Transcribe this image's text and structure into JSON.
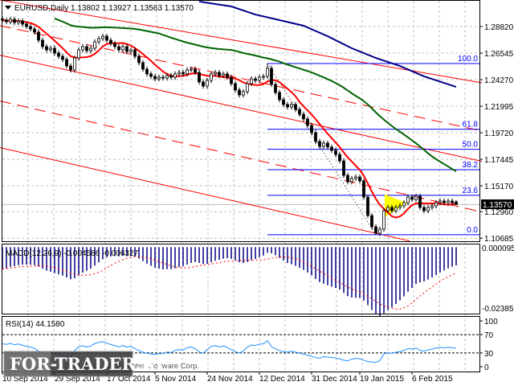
{
  "header": {
    "symbol": "EURUSD,Daily",
    "ohlc": "1.13802 1.13927 1.13563 1.13570"
  },
  "price_axis": {
    "ticks": [
      {
        "label": "1.28820",
        "value": 1.2882
      },
      {
        "label": "1.26545",
        "value": 1.26545
      },
      {
        "label": "1.24270",
        "value": 1.2427
      },
      {
        "label": "1.21995",
        "value": 1.21995
      },
      {
        "label": "1.19720",
        "value": 1.1972
      },
      {
        "label": "1.17445",
        "value": 1.17445
      },
      {
        "label": "1.15170",
        "value": 1.1517
      },
      {
        "label": "1.12960",
        "value": 1.1296
      },
      {
        "label": "1.10685",
        "value": 1.10685
      }
    ],
    "current_price": "1.13570",
    "current_value": 1.1357
  },
  "fibonacci": [
    {
      "label": "100.0",
      "value": 1.2565
    },
    {
      "label": "61.8",
      "value": 1.2002
    },
    {
      "label": "50.0",
      "value": 1.183
    },
    {
      "label": "38.2",
      "value": 1.1656
    },
    {
      "label": "23.6",
      "value": 1.1436
    },
    {
      "label": "0.0",
      "value": 1.1098
    }
  ],
  "macd": {
    "label": "MACD(12,26,9) -0.004586 -0.006327",
    "axis_max": "0.000095",
    "axis_min": "-0.023859",
    "max": 9.5e-05,
    "min": -0.023859
  },
  "rsi": {
    "label": "RSI(14) 44.1580",
    "levels": [
      {
        "label": "100",
        "value": 100
      },
      {
        "label": "70",
        "value": 70
      },
      {
        "label": "30",
        "value": 30
      },
      {
        "label": "0",
        "value": 0
      }
    ]
  },
  "dates": [
    {
      "label": "10 Sep 2014",
      "bar": 0
    },
    {
      "label": "29 Sep 2014",
      "bar": 13
    },
    {
      "label": "17 Oct 2014",
      "bar": 26
    },
    {
      "label": "5 Nov 2014",
      "bar": 38
    },
    {
      "label": "24 Nov 2014",
      "bar": 51
    },
    {
      "label": "12 Dec 2014",
      "bar": 64
    },
    {
      "label": "31 Dec 2014",
      "bar": 77
    },
    {
      "label": "19 Jan 2015",
      "bar": 89
    },
    {
      "label": "6 Feb 2015",
      "bar": 102
    }
  ],
  "watermark": {
    "logo": "FOR-TRADER.RU",
    "copyright": "MetaTrader 4, © 2001-2014, MetaQuotes Software Corp."
  },
  "colors": {
    "bull": "#ffffff",
    "bear": "#000000",
    "ma_fast": "#ff0000",
    "ma_mid": "#006400",
    "ma_slow": "#00008b",
    "fib": "#0000ff",
    "channel": "#ff0000",
    "macd_hist": "#000080",
    "macd_signal": "#ff0000",
    "rsi": "#1e90ff",
    "triangle": "#ffff00"
  },
  "chart_data": {
    "type": "candlestick",
    "title": "EURUSD,Daily",
    "last_bar": {
      "open": 1.13802,
      "high": 1.13927,
      "low": 1.13563,
      "close": 1.1357
    },
    "closes": [
      1.2937,
      1.2923,
      1.2944,
      1.2916,
      1.293,
      1.2903,
      1.2882,
      1.2861,
      1.2834,
      1.2765,
      1.271,
      1.2682,
      1.2696,
      1.2655,
      1.2627,
      1.26,
      1.2544,
      1.251,
      1.2613,
      1.2682,
      1.271,
      1.2675,
      1.2696,
      1.2751,
      1.2779,
      1.2799,
      1.2765,
      1.2737,
      1.271,
      1.2682,
      1.271,
      1.2668,
      1.2682,
      1.2627,
      1.2572,
      1.2517,
      1.2476,
      1.2455,
      1.2434,
      1.2448,
      1.2441,
      1.2462,
      1.2448,
      1.2476,
      1.2489,
      1.2476,
      1.251,
      1.2517,
      1.2489,
      1.2407,
      1.2372,
      1.242,
      1.2476,
      1.2489,
      1.2462,
      1.2476,
      1.2448,
      1.2393,
      1.2338,
      1.2296,
      1.2324,
      1.2393,
      1.2434,
      1.242,
      1.2448,
      1.2455,
      1.2524,
      1.2386,
      1.2317,
      1.2255,
      1.2214,
      1.2193,
      1.2214,
      1.2172,
      1.2131,
      1.209,
      1.2035,
      1.1973,
      1.1897,
      1.1855,
      1.1883,
      1.1849,
      1.1821,
      1.1786,
      1.1731,
      1.1607,
      1.1552,
      1.158,
      1.1593,
      1.1559,
      1.1421,
      1.1263,
      1.1166,
      1.1111,
      1.1146,
      1.1304,
      1.1332,
      1.1304,
      1.1332,
      1.1346,
      1.1373,
      1.1421,
      1.1401,
      1.1428,
      1.1332,
      1.1304,
      1.1332,
      1.1346,
      1.1373,
      1.1387,
      1.1373,
      1.1387,
      1.1373,
      1.1357
    ],
    "extremes": {
      "high": {
        "bar": 66,
        "price": 1.2567
      },
      "low": {
        "bar": 93,
        "price": 1.1098
      }
    },
    "ma_fast_period": 8,
    "ma_mid_period": 40,
    "ma_slow_points": [
      [
        49,
        1.3096
      ],
      [
        57,
        1.3054
      ],
      [
        63,
        1.2985
      ],
      [
        69,
        1.2937
      ],
      [
        75,
        1.2889
      ],
      [
        81,
        1.2799
      ],
      [
        87,
        1.2696
      ],
      [
        93,
        1.2613
      ],
      [
        99,
        1.2544
      ],
      [
        105,
        1.2455
      ],
      [
        113,
        1.2365
      ]
    ],
    "channel_lines": [
      {
        "style": "solid",
        "from": [
          -0.6,
          1.3109
        ],
        "to": [
          119.4,
          1.24
        ]
      },
      {
        "style": "dashed",
        "from": [
          -0.6,
          1.289
        ],
        "to": [
          119.4,
          1.1987
        ]
      },
      {
        "style": "solid",
        "from": [
          -0.6,
          1.2637
        ],
        "to": [
          119.4,
          1.1727
        ]
      },
      {
        "style": "dashed",
        "from": [
          -0.6,
          1.2244
        ],
        "to": [
          119.4,
          1.1293
        ]
      },
      {
        "style": "solid",
        "from": [
          -0.6,
          1.1844
        ],
        "to": [
          101.4,
          1.1045
        ]
      }
    ],
    "trend_line": {
      "from": [
        66,
        1.2567
      ],
      "to": [
        93,
        1.1098
      ]
    },
    "triangle": [
      [
        95.2,
        1.1445
      ],
      [
        95.2,
        1.1252
      ],
      [
        100.8,
        1.1369
      ]
    ],
    "ylim": [
      1.10685,
      1.3109
    ]
  }
}
